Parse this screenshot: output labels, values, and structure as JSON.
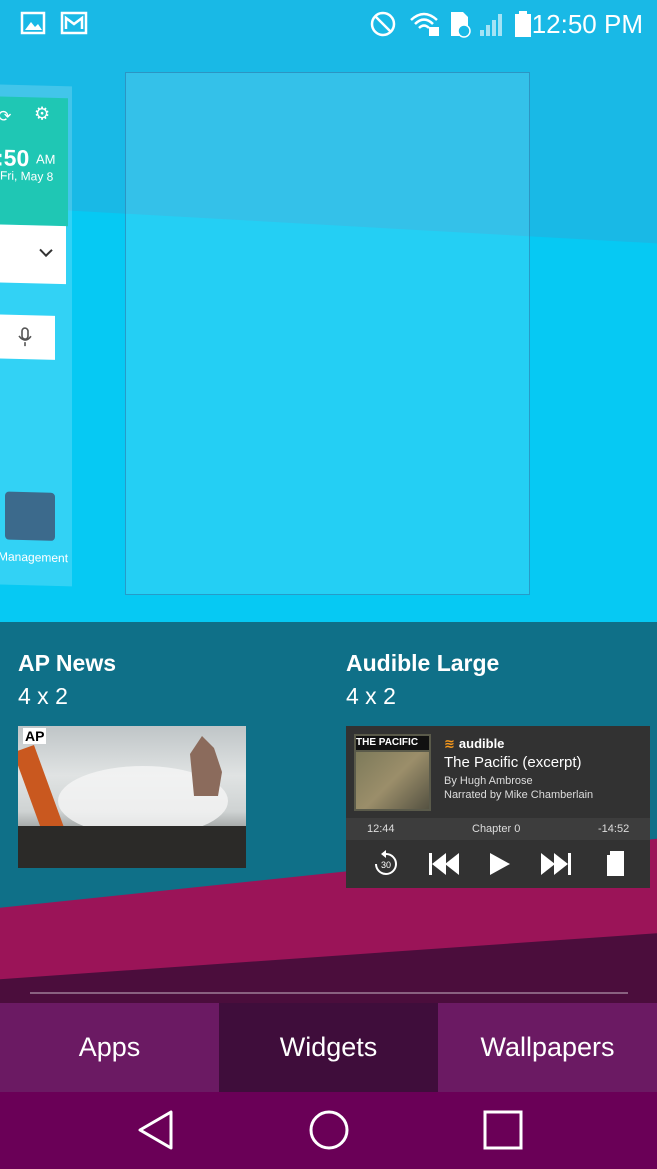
{
  "status_bar": {
    "time": "12:50 PM",
    "icons": [
      "gallery-icon",
      "gmail-icon",
      "do-not-disturb-icon",
      "wifi-lock-icon",
      "sd-card-icon",
      "signal-icon",
      "battery-icon"
    ]
  },
  "prev_home": {
    "time": ":50",
    "ampm": "AM",
    "date": "Fri, May 8",
    "management_label": "Management"
  },
  "widgets": [
    {
      "name": "AP News",
      "size": "4 x 2",
      "badge": "AP"
    },
    {
      "name": "Audible Large",
      "size": "4 x 2",
      "brand": "audible",
      "book_title": "The Pacific (excerpt)",
      "author": "By Hugh Ambrose",
      "narrator": "Narrated by Mike Chamberlain",
      "cover_title": "THE PACIFIC",
      "elapsed": "12:44",
      "chapter": "Chapter 0",
      "remaining": "-14:52",
      "skip_back_label": "30"
    }
  ],
  "tabs": [
    "Apps",
    "Widgets",
    "Wallpapers"
  ],
  "colors": {
    "wallpaper_sky": "#19b9e6",
    "tray_bg": "#0f7088",
    "tab_selected": "#3f0d3b",
    "tab_normal": "#6b1a63",
    "nav_bar": "#6a0057"
  }
}
